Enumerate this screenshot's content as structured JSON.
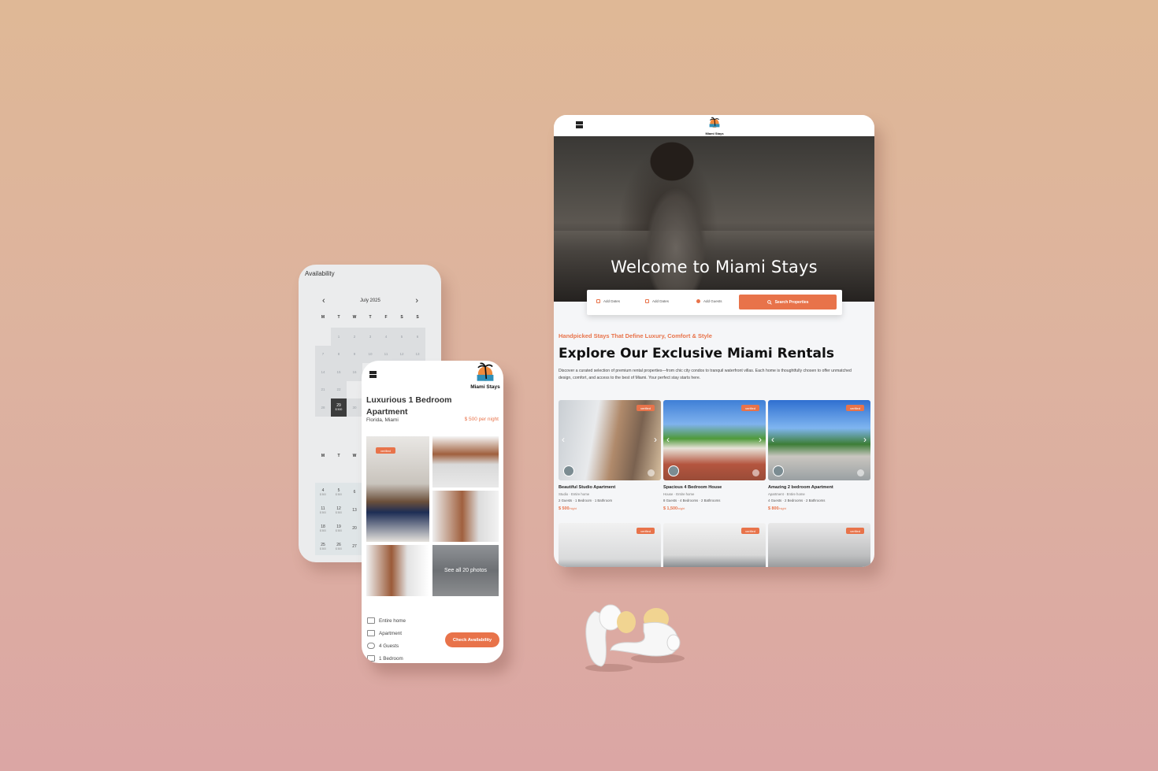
{
  "brand": {
    "name": "Miami Stays",
    "accent": "#e8734a"
  },
  "tablet": {
    "hero_title": "Welcome to Miami Stays",
    "search": {
      "checkin": "Add Dates",
      "checkout": "Add Dates",
      "guests": "Add Guests",
      "button": "Search Properties"
    },
    "tagline": "Handpicked Stays That Define Luxury, Comfort & Style",
    "heading": "Explore Our Exclusive Miami Rentals",
    "description": "Discover a curated selection of premium rental properties—from chic city condos to tranquil waterfront villas. Each home is thoughtfully chosen to offer unmatched design, comfort, and access to the best of Miami. Your perfect stay starts here.",
    "listings": [
      {
        "badge": "verified",
        "title": "Beautiful Studio Apartment",
        "type": "Studio · Entire home",
        "meta": "2 Guests · 1 Bedroom · 1 Bathroom",
        "price": "$ 500",
        "unit": "/night"
      },
      {
        "badge": "verified",
        "title": "Spacious 4 Bedroom House",
        "type": "House · Entire home",
        "meta": "8 Guests · 4 Bedrooms · 2 Bathrooms",
        "price": "$ 1,500",
        "unit": "/night"
      },
      {
        "badge": "verified",
        "title": "Amazing 2 bedroom Apartment",
        "type": "Apartment · Entire home",
        "meta": "4 Guests · 2 Bedrooms · 2 Bathrooms",
        "price": "$ 800",
        "unit": "/night"
      },
      {
        "badge": "verified"
      },
      {
        "badge": "verified"
      },
      {
        "badge": "verified"
      }
    ]
  },
  "calendar_phone": {
    "title": "Availability",
    "month": "July 2025",
    "weekdays": [
      "M",
      "T",
      "W",
      "T",
      "F",
      "S",
      "S"
    ],
    "weekdays_partial": [
      "M",
      "T",
      "W"
    ],
    "days_row1": [
      "",
      "1",
      "2",
      "3",
      "4",
      "5",
      "6"
    ],
    "days_row2": [
      "7",
      "8",
      "9",
      "10",
      "11",
      "12",
      "13"
    ],
    "days_row3": [
      "14",
      "15",
      "16"
    ],
    "days_row4": [
      "21",
      "22"
    ],
    "day_28": "28",
    "selected_day": "29",
    "selected_price": "$ 500",
    "day_30": "30",
    "second_month_days": [
      [
        "4",
        "5",
        "6"
      ],
      [
        "11",
        "12",
        "13"
      ],
      [
        "18",
        "19",
        "20"
      ],
      [
        "25",
        "26",
        "27"
      ]
    ],
    "second_month_price": "$ 500"
  },
  "detail_phone": {
    "title": "Luxurious 1 Bedroom Apartment",
    "location": "Florida, Miami",
    "price": "$ 500 per night",
    "badge": "verified",
    "see_all": "See all 20 photos",
    "features": [
      "Entire home",
      "Apartment",
      "4 Guests",
      "1 Bedroom"
    ],
    "cta": "Check Availability"
  }
}
